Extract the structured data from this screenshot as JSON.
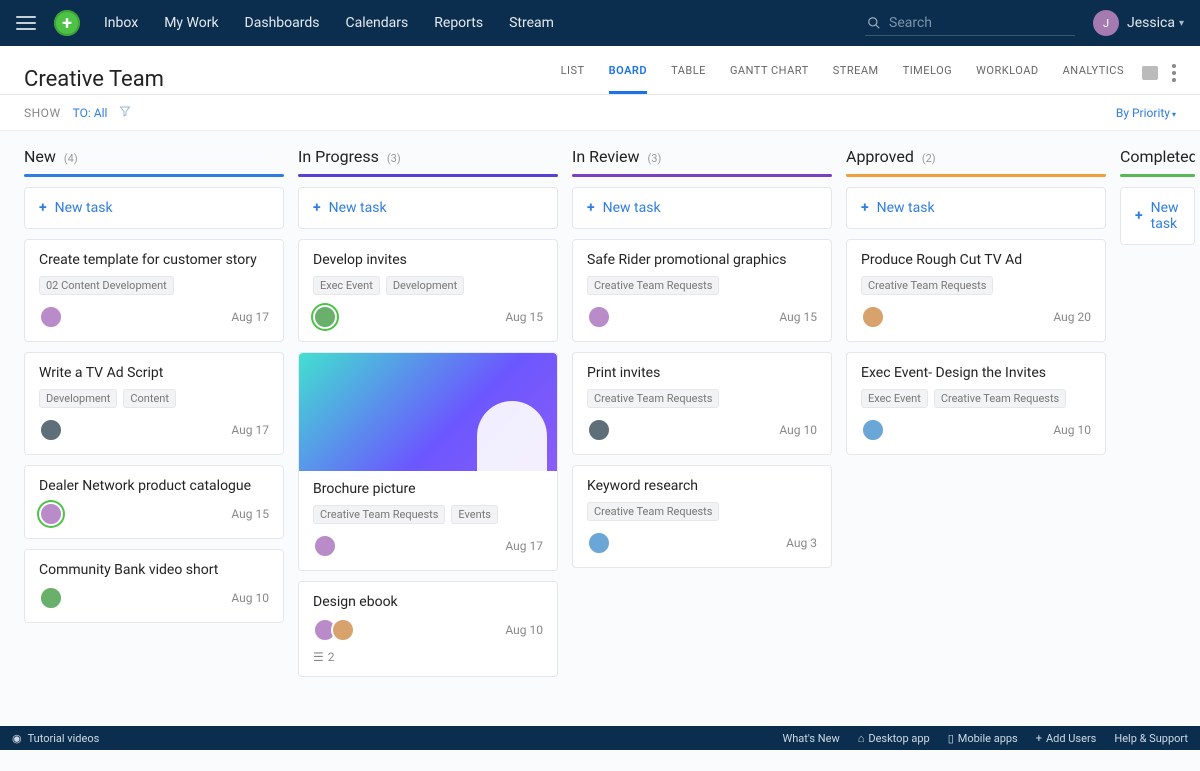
{
  "nav": {
    "links": [
      "Inbox",
      "My Work",
      "Dashboards",
      "Calendars",
      "Reports",
      "Stream"
    ],
    "search_placeholder": "Search",
    "user_name": "Jessica"
  },
  "header": {
    "title": "Creative Team",
    "tabs": [
      "LIST",
      "BOARD",
      "TABLE",
      "GANTT CHART",
      "STREAM",
      "TIMELOG",
      "WORKLOAD",
      "ANALYTICS"
    ],
    "active_tab": "BOARD"
  },
  "filters": {
    "show_label": "SHOW",
    "to_label": "TO:",
    "to_value": "All",
    "sort_label": "By Priority"
  },
  "new_task_label": "New task",
  "columns": [
    {
      "title": "New",
      "count": "(4)",
      "color": "#2f7de1",
      "cards": [
        {
          "title": "Create template for customer story",
          "tags": [
            "02 Content Development"
          ],
          "date": "Aug 17",
          "avatars": [
            "c1"
          ]
        },
        {
          "title": "Write a TV Ad Script",
          "tags": [
            "Development",
            "Content"
          ],
          "date": "Aug 17",
          "avatars": [
            "c6"
          ]
        },
        {
          "title": "Dealer Network product catalogue",
          "tags": [],
          "date": "Aug 15",
          "avatars": [
            "c1"
          ],
          "ring": true
        },
        {
          "title": "Community Bank video short",
          "tags": [],
          "date": "Aug 10",
          "avatars": [
            "c3"
          ]
        }
      ]
    },
    {
      "title": "In Progress",
      "count": "(3)",
      "color": "#5a3fd6",
      "cards": [
        {
          "title": "Develop invites",
          "tags": [
            "Exec Event",
            "Development"
          ],
          "date": "Aug 15",
          "avatars": [
            "c3"
          ],
          "ring": true
        },
        {
          "image": true,
          "title": "Brochure picture",
          "tags": [
            "Creative Team Requests",
            "Events"
          ],
          "date": "Aug 17",
          "avatars": [
            "c1"
          ]
        },
        {
          "title": "Design ebook",
          "tags": [],
          "date": "Aug 10",
          "avatars": [
            "c1",
            "c4"
          ],
          "subtasks": "2"
        }
      ]
    },
    {
      "title": "In Review",
      "count": "(3)",
      "color": "#7b3fc4",
      "cards": [
        {
          "title": "Safe Rider promotional graphics",
          "tags": [
            "Creative Team Requests"
          ],
          "date": "Aug 15",
          "avatars": [
            "c1"
          ]
        },
        {
          "title": "Print invites",
          "tags": [
            "Creative Team Requests"
          ],
          "date": "Aug 10",
          "avatars": [
            "c6"
          ]
        },
        {
          "title": "Keyword research",
          "tags": [
            "Creative Team Requests"
          ],
          "date": "Aug 3",
          "avatars": [
            "c2"
          ]
        }
      ]
    },
    {
      "title": "Approved",
      "count": "(2)",
      "color": "#f0a03a",
      "cards": [
        {
          "title": "Produce Rough Cut TV Ad",
          "tags": [
            "Creative Team Requests"
          ],
          "date": "Aug 20",
          "avatars": [
            "c4"
          ]
        },
        {
          "title": "Exec Event- Design the Invites",
          "tags": [
            "Exec Event",
            "Creative Team Requests"
          ],
          "date": "Aug 10",
          "avatars": [
            "c2"
          ]
        }
      ]
    },
    {
      "title": "Completed",
      "count": "",
      "color": "#58b858",
      "cards": []
    }
  ],
  "footer": {
    "tutorial": "Tutorial videos",
    "whats_new": "What's New",
    "desktop": "Desktop app",
    "mobile": "Mobile apps",
    "add_users": "Add Users",
    "help": "Help & Support"
  }
}
